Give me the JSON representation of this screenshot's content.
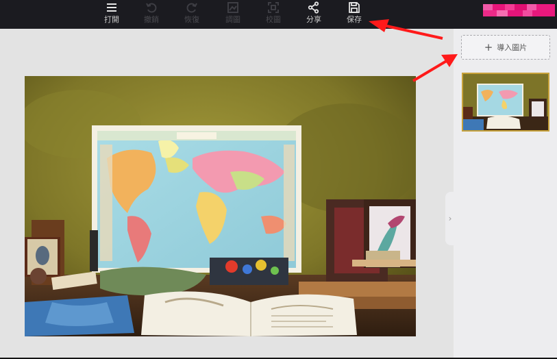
{
  "toolbar": {
    "items": [
      {
        "label": "打開",
        "icon": "menu-icon",
        "enabled": true
      },
      {
        "label": "撤銷",
        "icon": "undo-icon",
        "enabled": false
      },
      {
        "label": "恢復",
        "icon": "redo-icon",
        "enabled": false
      },
      {
        "label": "調圖",
        "icon": "adjust-image-icon",
        "enabled": false
      },
      {
        "label": "校圖",
        "icon": "crop-icon",
        "enabled": false
      },
      {
        "label": "分享",
        "icon": "share-icon",
        "enabled": true
      },
      {
        "label": "保存",
        "icon": "save-icon",
        "enabled": true
      }
    ]
  },
  "user": {
    "badge_color": "#e8157a"
  },
  "sidepanel": {
    "import_label": "導入圖片",
    "import_icon": "plus-icon",
    "collapse_icon": "chevron-right-icon"
  },
  "canvas": {
    "image_subject": "world map poster on an old desk"
  },
  "colors": {
    "accent": "#c8a23a",
    "annotation": "#ff1a1a"
  }
}
